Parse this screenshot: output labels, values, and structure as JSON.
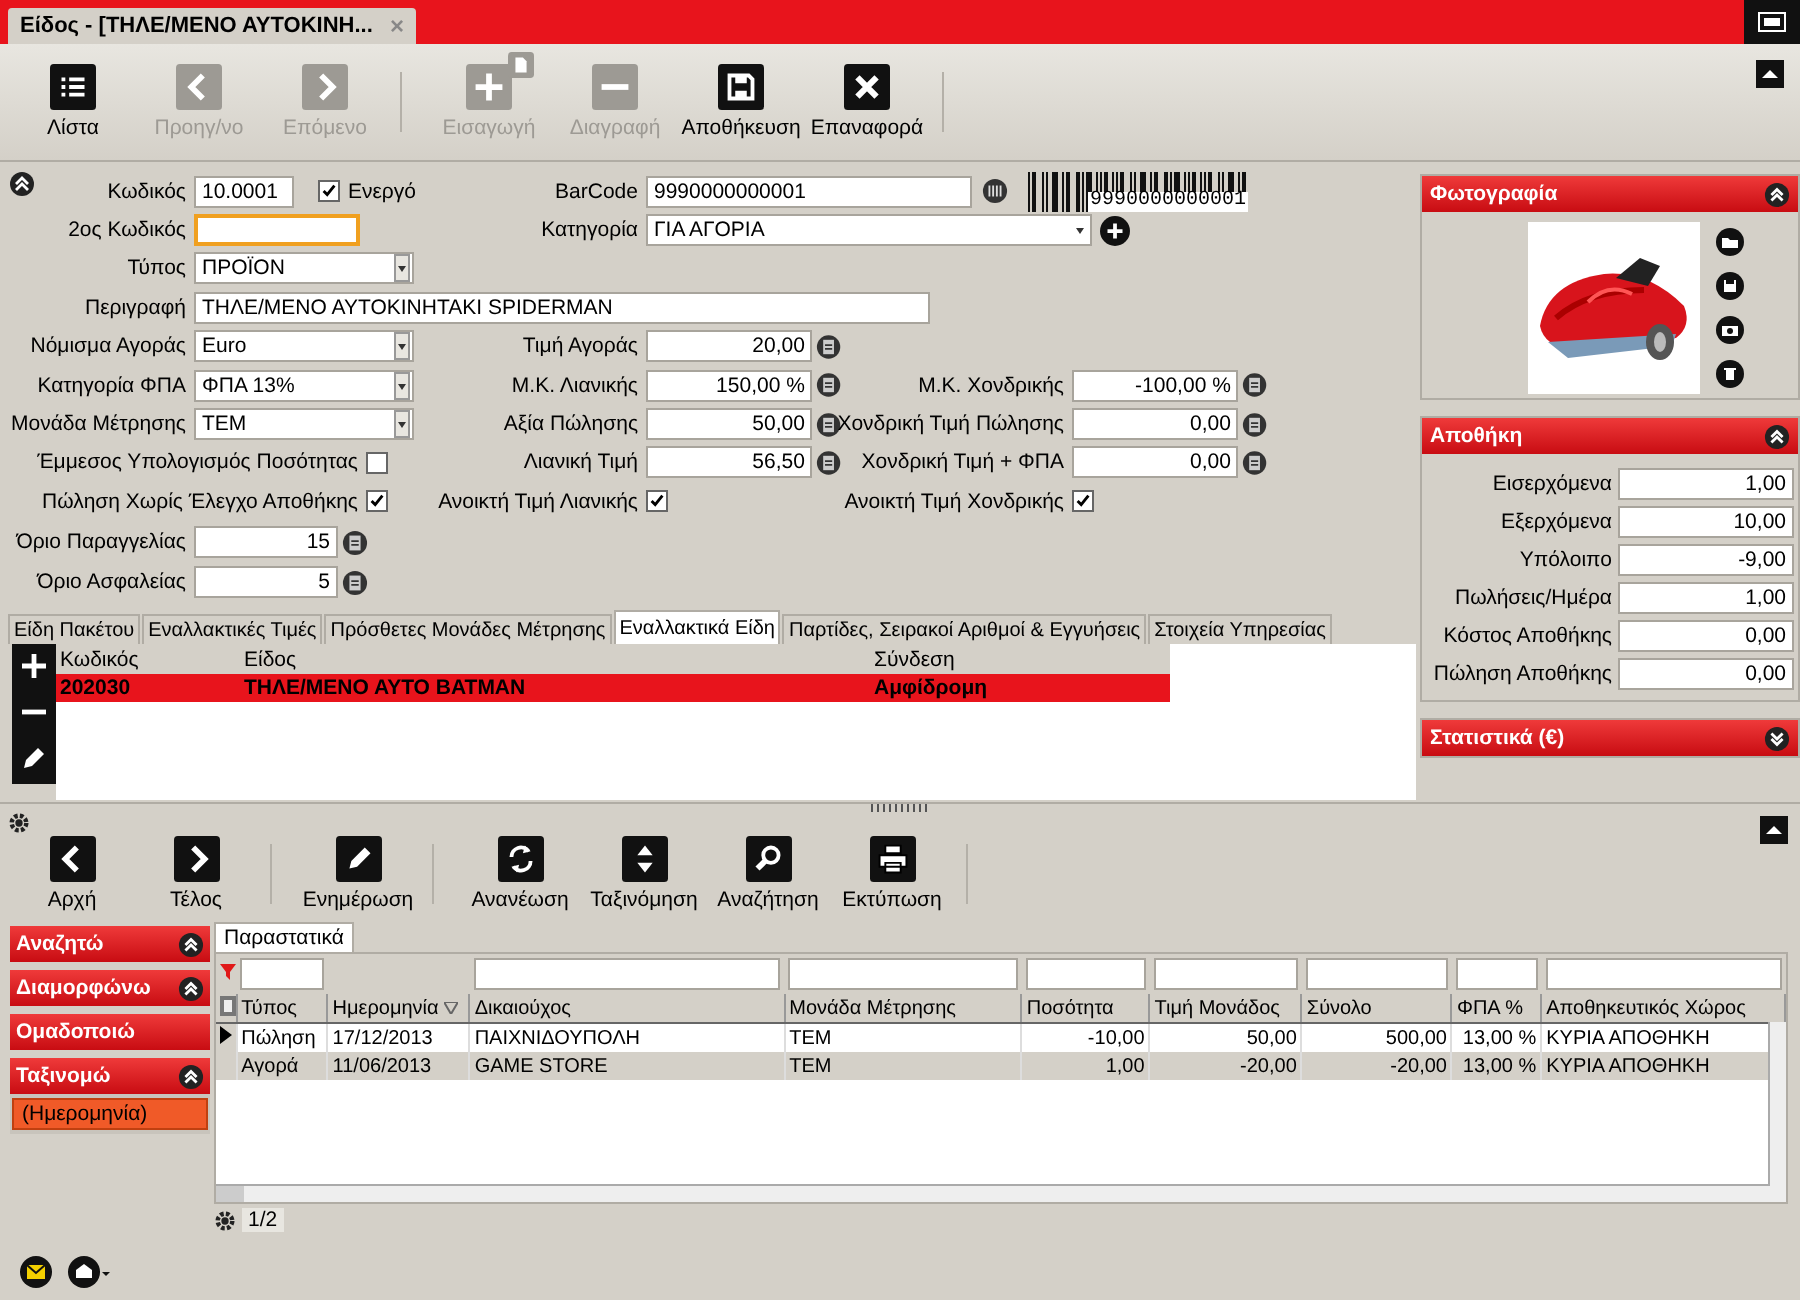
{
  "window": {
    "tab_title": "Είδος - [ΤΗΛΕ/ΜΕΝΟ ΑΥΤΟΚΙΝΗ...",
    "close": "×"
  },
  "toolbar": [
    {
      "kind": "list",
      "label": "Λίστα",
      "disabled": false
    },
    {
      "kind": "prev",
      "label": "Προηγ/νο",
      "disabled": true
    },
    {
      "kind": "next",
      "label": "Επόμενο",
      "disabled": true
    },
    {
      "kind": "add",
      "label": "Εισαγωγή",
      "disabled": true
    },
    {
      "kind": "remove",
      "label": "Διαγραφή",
      "disabled": true
    },
    {
      "kind": "save",
      "label": "Αποθήκευση",
      "disabled": false
    },
    {
      "kind": "reset",
      "label": "Επαναφορά",
      "disabled": false
    }
  ],
  "form": {
    "code": {
      "label": "Κωδικός",
      "value": "10.0001",
      "focused": false
    },
    "active": {
      "label": "Ενεργό",
      "checked": true
    },
    "barcode": {
      "label": "BarCode",
      "value": "9990000000001",
      "printed": "9990000000001"
    },
    "code2": {
      "label": "2ος Κωδικός",
      "focused": true
    },
    "category": {
      "label": "Κατηγορία",
      "value": "ΓΙΑ ΑΓΟΡΙΑ"
    },
    "type": {
      "label": "Τύπος",
      "value": "ΠΡΟΪΟΝ"
    },
    "description": {
      "label": "Περιγραφή",
      "value": "ΤΗΛΕ/ΜΕΝΟ ΑΥΤΟΚΙΝΗΤΑΚΙ SPIDERMAN"
    },
    "left_selects": [
      {
        "label": "Νόμισμα Αγοράς",
        "value": "Euro"
      },
      {
        "label": "Κατηγορία ΦΠΑ",
        "value": "ΦΠΑ 13%"
      },
      {
        "label": "Μονάδα Μέτρησης",
        "value": "ΤΕΜ"
      }
    ],
    "retail": [
      {
        "label": "Τιμή Αγοράς",
        "value": "20,00"
      },
      {
        "label": "Μ.Κ. Λιανικής",
        "value": "150,00 %"
      },
      {
        "label": "Αξία Πώλησης",
        "value": "50,00"
      },
      {
        "label": "Λιανική Τιμή",
        "value": "56,50"
      }
    ],
    "wholesale": [
      {
        "label": "Μ.Κ. Χονδρικής",
        "value": "-100,00 %"
      },
      {
        "label": "Χονδρική Τιμή Πώλησης",
        "value": "0,00"
      },
      {
        "label": "Χονδρική Τιμή + ΦΠΑ",
        "value": "0,00"
      }
    ],
    "indirect_qty": {
      "label": "Έμμεσος Υπολογισμός Ποσότητας",
      "checked": false
    },
    "no_stock_check": {
      "label": "Πώληση Χωρίς Έλεγχο Αποθήκης",
      "checked": true
    },
    "open_retail": {
      "label": "Ανοικτή Τιμή Λιανικής",
      "checked": true
    },
    "open_wholesale": {
      "label": "Ανοικτή Τιμή Χονδρικής",
      "checked": true
    },
    "limits": [
      {
        "label": "Όριο Παραγγελίας",
        "value": "15"
      },
      {
        "label": "Όριο Ασφαλείας",
        "value": "5"
      }
    ]
  },
  "photo_panel": {
    "title": "Φωτογραφία",
    "expanded": true
  },
  "stock_panel": {
    "title": "Αποθήκη",
    "expanded": true,
    "rows": [
      {
        "label": "Εισερχόμενα",
        "value": "1,00"
      },
      {
        "label": "Εξερχόμενα",
        "value": "10,00"
      },
      {
        "label": "Υπόλοιπο",
        "value": "-9,00"
      },
      {
        "label": "Πωλήσεις/Ημέρα",
        "value": "1,00"
      },
      {
        "label": "Κόστος Αποθήκης",
        "value": "0,00"
      },
      {
        "label": "Πώληση Αποθήκης",
        "value": "0,00"
      }
    ]
  },
  "stats_panel": {
    "title": "Στατιστικά (€)",
    "expanded": false
  },
  "tabs": [
    {
      "label": "Είδη Πακέτου",
      "selected": false
    },
    {
      "label": "Εναλλακτικές Τιμές",
      "selected": false
    },
    {
      "label": "Πρόσθετες Μονάδες Μέτρησης",
      "selected": false
    },
    {
      "label": "Εναλλακτικά Είδη",
      "selected": true
    },
    {
      "label": "Παρτίδες, Σειρακοί Αριθμοί & Εγγυήσεις",
      "selected": false
    },
    {
      "label": "Στοιχεία Υπηρεσίας",
      "selected": false
    }
  ],
  "alt_items": {
    "columns": [
      "Κωδικός",
      "Είδος",
      "Σύνδεση"
    ],
    "rows": [
      {
        "cells": [
          "202030",
          "ΤΗΛΕ/ΜΕΝΟ ΑΥΤΟ BATMAN",
          "Αμφίδρομη"
        ],
        "selected": true
      }
    ]
  },
  "list_toolbar": [
    {
      "kind": "first",
      "label": "Αρχή"
    },
    {
      "kind": "last",
      "label": "Τέλος"
    },
    {
      "kind": "edit",
      "label": "Ενημέρωση"
    },
    {
      "kind": "refresh",
      "label": "Ανανέωση"
    },
    {
      "kind": "sort",
      "label": "Ταξινόμηση"
    },
    {
      "kind": "search",
      "label": "Αναζήτηση"
    },
    {
      "kind": "print",
      "label": "Εκτύπωση"
    }
  ],
  "side_groups": [
    {
      "label": "Αναζητώ",
      "collapsible": true
    },
    {
      "label": "Διαμορφώνω",
      "collapsible": true
    },
    {
      "label": "Ομαδοποιώ",
      "collapsible": false
    },
    {
      "label": "Ταξινομώ",
      "collapsible": true,
      "items": [
        "(Ημερομηνία)"
      ]
    }
  ],
  "documents": {
    "tab": "Παραστατικά",
    "columns": [
      {
        "label": "Τύπος",
        "filter": true,
        "sorted": false
      },
      {
        "label": "Ημερομηνία",
        "filter": false,
        "sorted": true
      },
      {
        "label": "Δικαιούχος",
        "filter": true,
        "sorted": false
      },
      {
        "label": "Μονάδα Μέτρησης",
        "filter": true,
        "sorted": false
      },
      {
        "label": "Ποσότητα",
        "filter": true,
        "sorted": false
      },
      {
        "label": "Τιμή Μονάδος",
        "filter": true,
        "sorted": false
      },
      {
        "label": "Σύνολο",
        "filter": true,
        "sorted": false
      },
      {
        "label": "ΦΠΑ %",
        "filter": true,
        "sorted": false
      },
      {
        "label": "Αποθηκευτικός Χώρος",
        "filter": true,
        "sorted": false
      }
    ],
    "rows": [
      {
        "current": true,
        "selected": false,
        "cells": [
          "Πώληση",
          "17/12/2013",
          "ΠΑΙΧΝΙΔΟΥΠΟΛΗ",
          "TEM",
          "-10,00",
          "50,00",
          "500,00",
          "13,00 %",
          "ΚΥΡΙΑ ΑΠΟΘΗΚΗ"
        ]
      },
      {
        "current": false,
        "selected": true,
        "cells": [
          "Αγορά",
          "11/06/2013",
          "GAME STORE",
          "TEM",
          "1,00",
          "-20,00",
          "-20,00",
          "13,00 %",
          "ΚΥΡΙΑ ΑΠΟΘΗΚΗ"
        ]
      }
    ],
    "pager": "1/2"
  }
}
